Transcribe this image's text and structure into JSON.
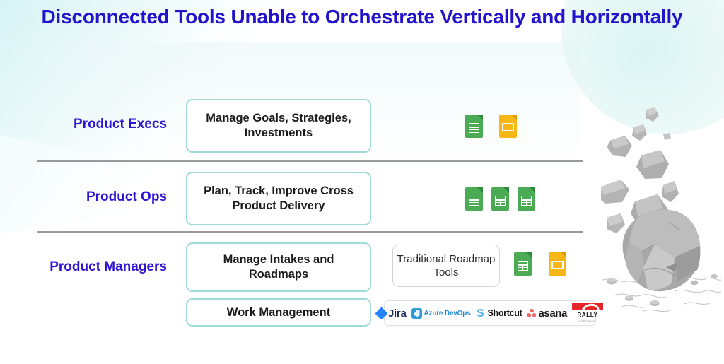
{
  "title": "Disconnected Tools Unable to Orchestrate Vertically and Horizontally",
  "colors": {
    "title": "#2313cc",
    "row_label": "#2d14d4",
    "box_border_teal": "#9fdcd9",
    "box_border_grey": "#d3d3d3",
    "divider": "#9a9a9a",
    "sheets_green": "#4bab55",
    "slides_yellow": "#f7b716",
    "jira_blue": "#2684ff",
    "azure_blue": "#1c8ad6",
    "shortcut_blue": "#58b7f0",
    "asana_red": "#f06a6a",
    "rally_red": "#e8252a",
    "background": "#ffffff",
    "wash_teal": "#cdf0f0"
  },
  "rows": [
    {
      "label": "Product Execs",
      "boxes": [
        {
          "text": "Manage Goals, Strategies, Investments"
        }
      ],
      "icons": [
        {
          "name": "google-sheets-icon",
          "type": "sheets"
        },
        {
          "name": "google-slides-icon",
          "type": "slides"
        }
      ]
    },
    {
      "label": "Product Ops",
      "boxes": [
        {
          "text": "Plan, Track, Improve Cross Product Delivery"
        }
      ],
      "icons": [
        {
          "name": "google-sheets-icon",
          "type": "sheets"
        },
        {
          "name": "google-sheets-icon",
          "type": "sheets"
        },
        {
          "name": "google-sheets-icon",
          "type": "sheets"
        }
      ]
    },
    {
      "label": "Product Managers",
      "boxes": [
        {
          "text": "Manage Intakes and Roadmaps"
        },
        {
          "text": "Work Management"
        }
      ],
      "traditional_box": "Traditional Roadmap Tools",
      "icons": [
        {
          "name": "google-sheets-icon",
          "type": "sheets"
        },
        {
          "name": "google-slides-icon",
          "type": "slides"
        }
      ]
    }
  ],
  "logo_strip": [
    {
      "name": "jira-logo",
      "label": "Jira"
    },
    {
      "name": "azure-devops-logo",
      "label": "Azure DevOps"
    },
    {
      "name": "shortcut-logo",
      "label": "Shortcut"
    },
    {
      "name": "asana-logo",
      "label": "asana"
    },
    {
      "name": "rally-logo",
      "label": "RALLY",
      "sublabel": "SOFTWARE"
    }
  ],
  "illustration": {
    "name": "falling-boulder-illustration",
    "description": "Grey boulder with falling rocks"
  }
}
